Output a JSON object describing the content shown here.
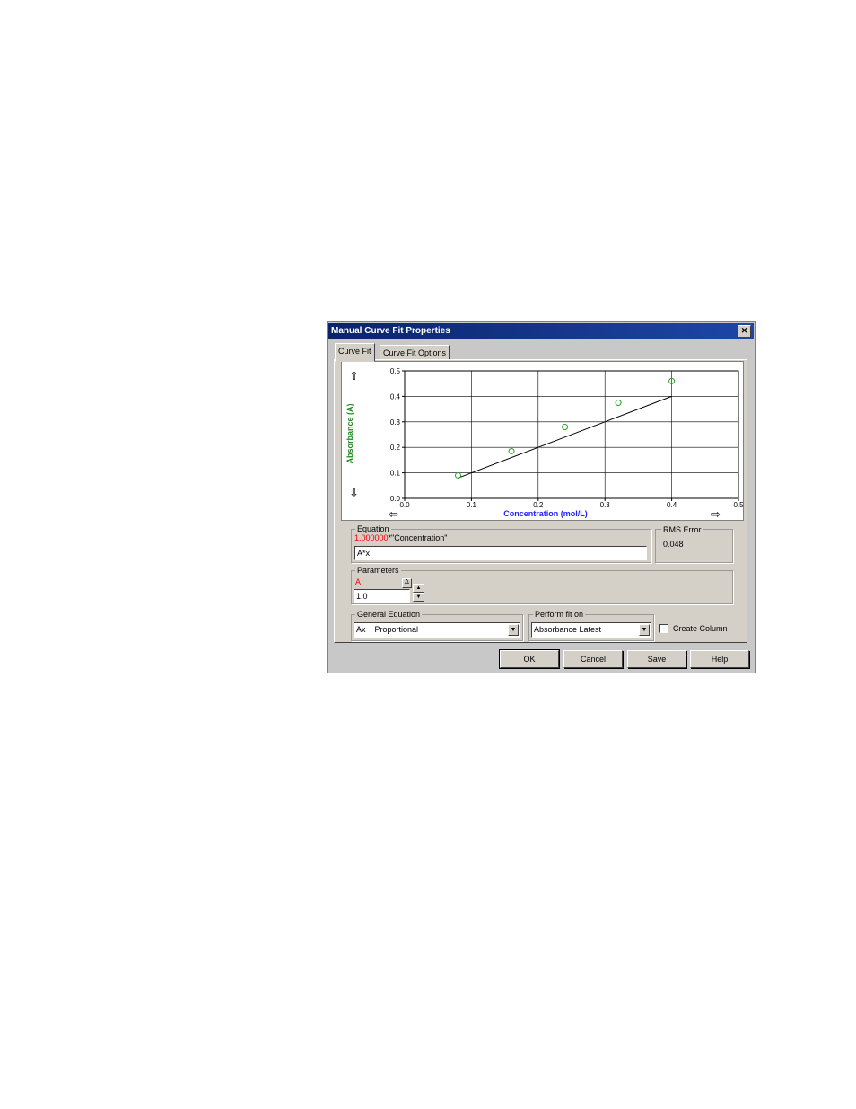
{
  "window": {
    "title": "Manual Curve Fit Properties",
    "close_glyph": "✕"
  },
  "tabs": [
    {
      "label": "Curve Fit",
      "active": true
    },
    {
      "label": "Curve Fit Options",
      "active": false
    }
  ],
  "chart_data": {
    "type": "scatter",
    "xlabel": "Concentration (mol/L)",
    "ylabel": "Absorbance (A)",
    "xlim": [
      0.0,
      0.5
    ],
    "ylim": [
      0.0,
      0.5
    ],
    "x_ticks": [
      "0.0",
      "0.1",
      "0.2",
      "0.3",
      "0.4",
      "0.5"
    ],
    "y_ticks": [
      "0.0",
      "0.1",
      "0.2",
      "0.3",
      "0.4",
      "0.5"
    ],
    "grid": true,
    "series": [
      {
        "kind": "points",
        "color": "#2e9a2e",
        "x": [
          0.08,
          0.16,
          0.24,
          0.32,
          0.4
        ],
        "y": [
          0.09,
          0.185,
          0.28,
          0.375,
          0.46
        ]
      },
      {
        "kind": "line",
        "color": "#000000",
        "x": [
          0.08,
          0.4
        ],
        "y": [
          0.08,
          0.4
        ]
      }
    ],
    "xlabel_color": "#1f1fff",
    "ylabel_color": "#1e8a1e"
  },
  "equation": {
    "label": "Equation",
    "coefficient": "1.000000",
    "rest": "*\"Concentration\"",
    "input_value": "A*x"
  },
  "rms": {
    "label": "RMS Error",
    "value": "0.048"
  },
  "parameters": {
    "label": "Parameters",
    "name": "A",
    "delta": "Δ",
    "value": "1.0"
  },
  "general_equation": {
    "label": "General Equation",
    "code": "Ax",
    "name": "Proportional"
  },
  "perform_fit": {
    "label": "Perform fit on",
    "value": "Absorbance Latest"
  },
  "create_column": {
    "label": "Create Column",
    "checked": false
  },
  "buttons": {
    "ok": "OK",
    "cancel": "Cancel",
    "save": "Save",
    "help": "Help"
  },
  "icons": {
    "up": "⇧",
    "down": "⇩",
    "left": "⇦",
    "right": "⇨",
    "arrow_down": "▼",
    "arrow_up": "▲"
  }
}
